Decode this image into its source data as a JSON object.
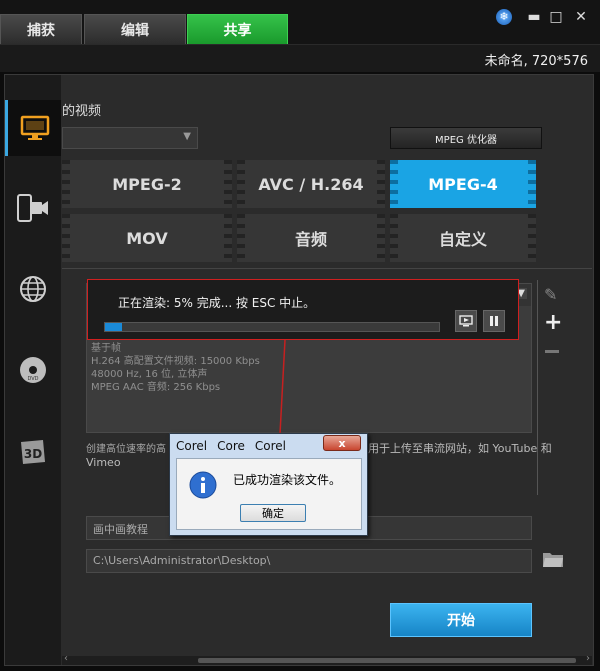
{
  "tabs": [
    {
      "label": "捕获"
    },
    {
      "label": "编辑"
    },
    {
      "label": "共享"
    }
  ],
  "project_title": "未命名, 720*576",
  "section_heading": "的视频",
  "optimizer_button": "MPEG 优化器",
  "formats": [
    {
      "label": "MPEG-2"
    },
    {
      "label": "AVC / H.264"
    },
    {
      "label": "MPEG-4"
    },
    {
      "label": "MOV"
    },
    {
      "label": "音频"
    },
    {
      "label": "自定义"
    }
  ],
  "profile_info": {
    "lines": [
      "基于帧",
      "H.264 高配置文件视频: 15000 Kbps",
      "48000 Hz, 16 位, 立体声",
      "MPEG AAC 音频: 256 Kbps"
    ]
  },
  "description": {
    "left": "创建高位速率的高",
    "right": "用于上传至串流网站，如 YouTube 和",
    "line2": "Vimeo"
  },
  "file_name": "画中画教程",
  "file_path": "C:\\Users\\Administrator\\Desktop\\",
  "start_button": "开始",
  "render": {
    "status": "正在渲染: 5% 完成... 按 ESC 中止。",
    "progress_percent": 5
  },
  "dialog": {
    "title_tabs": [
      "Corel",
      "Core",
      "Corel"
    ],
    "close_label": "x",
    "message": "已成功渲染该文件。",
    "ok_label": "确定"
  },
  "colors": {
    "accent_green": "#1a9a2c",
    "accent_blue": "#1aa4e4",
    "highlight_red": "#d02020"
  }
}
